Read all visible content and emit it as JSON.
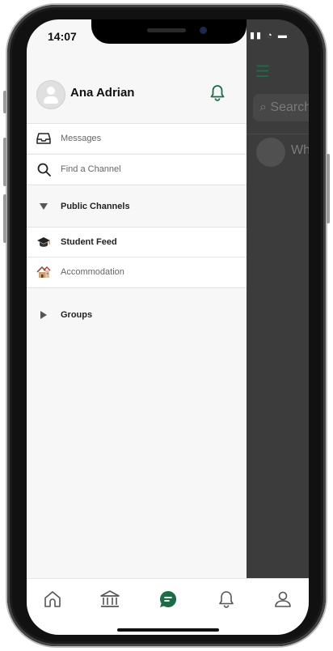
{
  "status_bar": {
    "time": "14:07"
  },
  "profile": {
    "name": "Ana Adrian"
  },
  "menu": {
    "messages": "Messages",
    "find_channel": "Find a Channel",
    "public_channels": "Public Channels",
    "channels": [
      {
        "label": "Student Feed",
        "icon": "graduation-cap-icon"
      },
      {
        "label": "Accommodation",
        "icon": "house-icon"
      }
    ],
    "groups": "Groups"
  },
  "background_view": {
    "search_partial": "Search",
    "preview_partial": "Wh"
  },
  "colors": {
    "accent": "#1e6b4a",
    "overlay": "#3c3c3c"
  },
  "tabbar": {
    "tabs": [
      {
        "icon": "home-icon",
        "active": false
      },
      {
        "icon": "bank-icon",
        "active": false
      },
      {
        "icon": "chat-icon",
        "active": true
      },
      {
        "icon": "bell-icon",
        "active": false
      },
      {
        "icon": "profile-icon",
        "active": false
      }
    ]
  }
}
